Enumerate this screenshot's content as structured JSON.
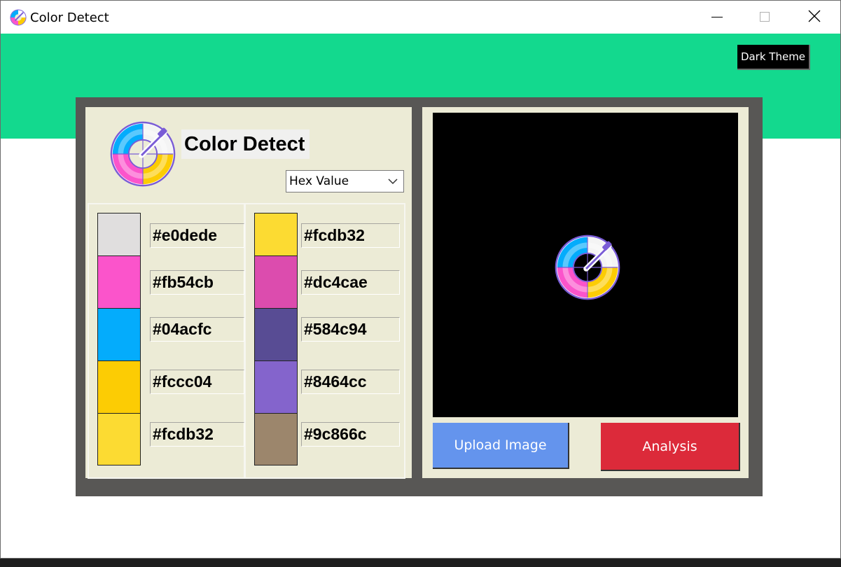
{
  "window": {
    "title": "Color Detect",
    "icon": "color-wheel-picker-icon",
    "controls": [
      "minimize-icon",
      "maximize-icon",
      "close-icon"
    ]
  },
  "header": {
    "theme_button_label": "Dark Theme",
    "background_color": "#13d98e"
  },
  "left_panel": {
    "title": "Color Detect",
    "logo_icon": "color-wheel-picker-icon",
    "format_select": {
      "selected": "Hex Value"
    },
    "swatches_left": [
      {
        "color": "#e0dede",
        "label": "#e0dede"
      },
      {
        "color": "#fb54cb",
        "label": "#fb54cb"
      },
      {
        "color": "#04acfc",
        "label": "#04acfc"
      },
      {
        "color": "#fccc04",
        "label": "#fccc04"
      },
      {
        "color": "#fcdb32",
        "label": "#fcdb32"
      }
    ],
    "swatches_right": [
      {
        "color": "#fcdb32",
        "label": "#fcdb32"
      },
      {
        "color": "#dc4cae",
        "label": "#dc4cae"
      },
      {
        "color": "#584c94",
        "label": "#584c94"
      },
      {
        "color": "#8464cc",
        "label": "#8464cc"
      },
      {
        "color": "#9c866c",
        "label": "#9c866c"
      }
    ]
  },
  "right_panel": {
    "preview_icon": "color-wheel-picker-icon",
    "upload_button_label": "Upload Image",
    "analysis_button_label": "Analysis",
    "upload_color": "#6494ed",
    "analysis_color": "#dc2a3a"
  }
}
